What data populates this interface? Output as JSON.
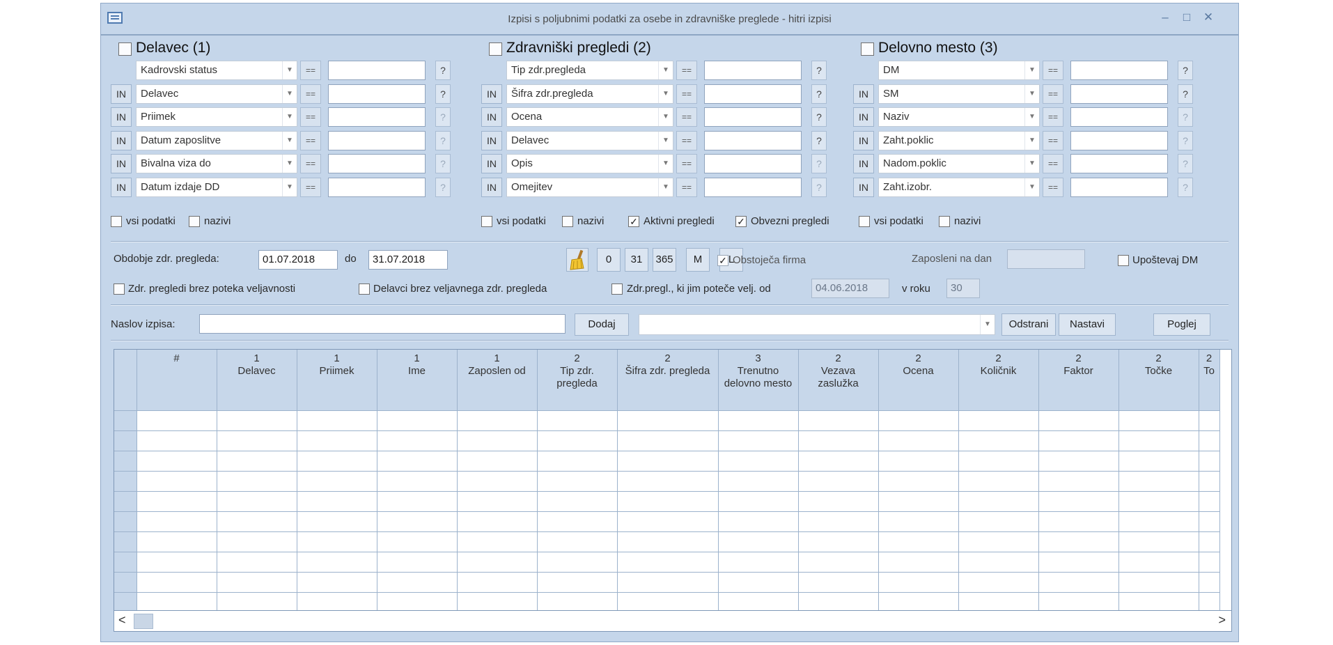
{
  "window": {
    "title": "Izpisi s poljubnimi podatki za osebe in zdravniške preglede - hitri izpisi",
    "min": "–",
    "max": "□",
    "close": "✕"
  },
  "icons": {
    "app": "window-list-icon",
    "broom": "broom-clear-icon",
    "combo_arrow": "▼",
    "scroll_left": "<",
    "scroll_right": ">"
  },
  "sections": [
    {
      "title": "Delavec (1)",
      "rows": [
        {
          "in": "",
          "field": "Kadrovski status",
          "op": "==",
          "value": "",
          "q": "?"
        },
        {
          "in": "IN",
          "field": "Delavec",
          "op": "==",
          "value": "",
          "q": "?"
        },
        {
          "in": "IN",
          "field": "Priimek",
          "op": "==",
          "value": "",
          "q": "?"
        },
        {
          "in": "IN",
          "field": "Datum zaposlitve",
          "op": "==",
          "value": "",
          "q": "?"
        },
        {
          "in": "IN",
          "field": "Bivalna viza do",
          "op": "==",
          "value": "",
          "q": "?"
        },
        {
          "in": "IN",
          "field": "Datum izdaje DD",
          "op": "==",
          "value": "",
          "q": "?"
        }
      ],
      "options": [
        "vsi podatki",
        "nazivi"
      ]
    },
    {
      "title": "Zdravniški pregledi (2)",
      "rows": [
        {
          "in": "",
          "field": "Tip zdr.pregleda",
          "op": "==",
          "value": "",
          "q": "?"
        },
        {
          "in": "IN",
          "field": "Šifra zdr.pregleda",
          "op": "==",
          "value": "",
          "q": "?"
        },
        {
          "in": "IN",
          "field": "Ocena",
          "op": "==",
          "value": "",
          "q": "?"
        },
        {
          "in": "IN",
          "field": "Delavec",
          "op": "==",
          "value": "",
          "q": "?"
        },
        {
          "in": "IN",
          "field": "Opis",
          "op": "==",
          "value": "",
          "q": "?"
        },
        {
          "in": "IN",
          "field": "Omejitev",
          "op": "==",
          "value": "",
          "q": "?"
        }
      ],
      "options": [
        "vsi podatki",
        "nazivi",
        "Aktivni pregledi",
        "Obvezni pregledi"
      ]
    },
    {
      "title": "Delovno mesto (3)",
      "rows": [
        {
          "in": "",
          "field": "DM",
          "op": "==",
          "value": "",
          "q": "?"
        },
        {
          "in": "IN",
          "field": "SM",
          "op": "==",
          "value": "",
          "q": "?"
        },
        {
          "in": "IN",
          "field": "Naziv",
          "op": "==",
          "value": "",
          "q": "?"
        },
        {
          "in": "IN",
          "field": "Zaht.poklic",
          "op": "==",
          "value": "",
          "q": "?"
        },
        {
          "in": "IN",
          "field": "Nadom.poklic",
          "op": "==",
          "value": "",
          "q": "?"
        },
        {
          "in": "IN",
          "field": "Zaht.izobr.",
          "op": "==",
          "value": "",
          "q": "?"
        }
      ],
      "options": [
        "vsi podatki",
        "nazivi"
      ]
    }
  ],
  "period": {
    "label": "Obdobje zdr. pregleda:",
    "from": "01.07.2018",
    "to_label": "do",
    "to": "31.07.2018",
    "buttons": [
      "0",
      "31",
      "365",
      "M",
      "L"
    ],
    "obstojeca_firma": "Obstoječa firma",
    "zaposleni_label": "Zaposleni na dan",
    "zaposleni_value": "",
    "upostevaj_dm": "Upoštevaj DM"
  },
  "filters": {
    "brez_poteka": "Zdr. pregledi brez poteka veljavnosti",
    "brez_veljavnega": "Delavci brez veljavnega zdr. pregleda",
    "potece_label": "Zdr.pregl., ki jim poteče velj. od",
    "potece_date": "04.06.2018",
    "v_roku_label": "v roku",
    "v_roku_value": "30"
  },
  "report": {
    "title_label": "Naslov izpisa:",
    "title_value": "",
    "dodaj": "Dodaj",
    "saved_value": "",
    "odstrani": "Odstrani",
    "nastavi": "Nastavi",
    "poglej": "Poglej"
  },
  "grid": {
    "columns": [
      {
        "num": "",
        "label": "#"
      },
      {
        "num": "1",
        "label": "Delavec"
      },
      {
        "num": "1",
        "label": "Priimek"
      },
      {
        "num": "1",
        "label": "Ime"
      },
      {
        "num": "1",
        "label": "Zaposlen od"
      },
      {
        "num": "2",
        "label": "Tip zdr. pregleda"
      },
      {
        "num": "2",
        "label": "Šifra zdr. pregleda"
      },
      {
        "num": "3",
        "label": "Trenutno delovno mesto"
      },
      {
        "num": "2",
        "label": "Vezava zaslužka"
      },
      {
        "num": "2",
        "label": "Ocena"
      },
      {
        "num": "2",
        "label": "Količnik"
      },
      {
        "num": "2",
        "label": "Faktor"
      },
      {
        "num": "2",
        "label": "Točke"
      },
      {
        "num": "2",
        "label": "To"
      }
    ],
    "empty_rows": 10
  }
}
